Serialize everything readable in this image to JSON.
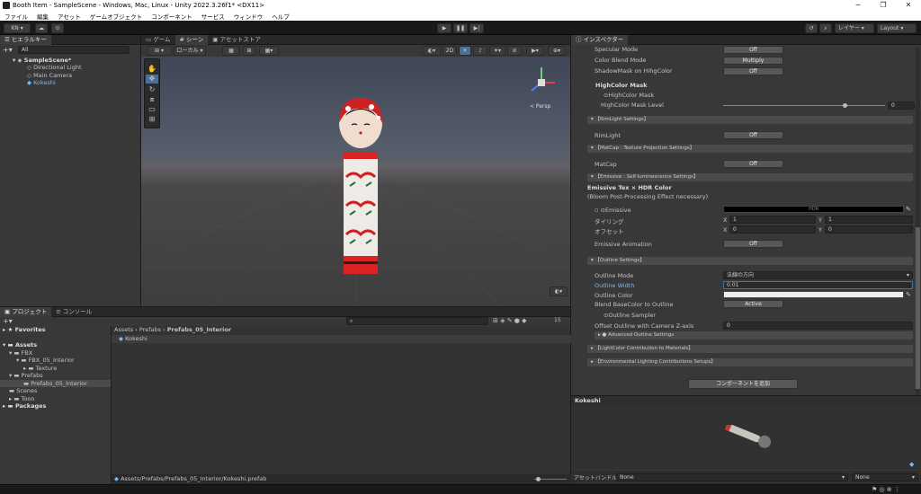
{
  "window": {
    "title": "Booth Item - SampleScene - Windows, Mac, Linux - Unity 2022.3.26f1* <DX11>"
  },
  "menu": [
    "ファイル",
    "編集",
    "アセット",
    "ゲームオブジェクト",
    "コンポーネント",
    "サービス",
    "ウィンドウ",
    "ヘルプ"
  ],
  "toolbar": {
    "account": "KN ▾",
    "layers": "レイヤー",
    "layout": "Layout"
  },
  "hierarchy": {
    "tab": "ヒエラルキー",
    "search": "All",
    "scene": "SampleScene*",
    "items": [
      "Directional Light",
      "Main Camera",
      "Kokeshi"
    ]
  },
  "scene_view": {
    "tabs": [
      "ゲーム",
      "シーン",
      "アセットストア"
    ],
    "pivot": "ローカル",
    "mode_2d": "2D",
    "persp": "< Persp"
  },
  "project": {
    "tabs": [
      "プロジェクト",
      "コンソール"
    ],
    "count": "15",
    "favorites": "Favorites",
    "assets": "Assets",
    "tree": [
      "FBX",
      "FBX_05_Interior",
      "Texture",
      "Prefabs",
      "Prefabs_05_Interior",
      "Scenes",
      "Toon"
    ],
    "packages": "Packages",
    "breadcrumb": [
      "Assets",
      "Prefabs",
      "Prefabs_05_Interior"
    ],
    "file": "Kokeshi",
    "path": "Assets/Prefabs/Prefabs_05_Interior/Kokeshi.prefab"
  },
  "inspector": {
    "tab": "インスペクター",
    "specular": {
      "label": "Specular Mode",
      "value": "Off"
    },
    "blend": {
      "label": "Color Blend Mode",
      "value": "Multiply"
    },
    "shadowmask": {
      "label": "ShadowMask on HihgColor",
      "value": "Off"
    },
    "highcolor_mask_title": "HighColor Mask",
    "highcolor_mask": "HighColor Mask",
    "highcolor_level": {
      "label": "HighColor Mask Level",
      "value": "0",
      "fraction": 0.75
    },
    "rimlight_hdr": "【RimLight Settings】",
    "rimlight": {
      "label": "RimLight",
      "value": "Off"
    },
    "matcap_hdr": "【MatCap : Texture Projection Settings】",
    "matcap": {
      "label": "MatCap",
      "value": "Off"
    },
    "emissive_hdr": "【Emissive : Self-luminescence Settings】",
    "emissive_title": "Emissive Tex × HDR Color",
    "emissive_sub": "(Bloom Post-Processing Effect necessary)",
    "emissive": "Emissive",
    "emissive_color_label": "HDR",
    "tiling": {
      "label": "タイリング",
      "x": "1",
      "y": "1"
    },
    "offset": {
      "label": "オフセット",
      "x": "0",
      "y": "0"
    },
    "emissive_anim": {
      "label": "Emissive Animation",
      "value": "Off"
    },
    "outline_hdr": "【Outline Settings】",
    "outline_mode": {
      "label": "Outline Mode",
      "value": "法線の方向"
    },
    "outline_width": {
      "label": "Outline Width",
      "value": "0.01"
    },
    "outline_color": {
      "label": "Outline Color"
    },
    "blend_base": {
      "label": "Blend BaseColor to Outline",
      "value": "Active"
    },
    "outline_sampler": "Outline Sampler",
    "offset_outline": {
      "label": "Offset Outline with Camera Z-axis",
      "value": "0"
    },
    "adv_outline": "● Advanced Outline Settings",
    "lightcolor_hdr": "【LightColor Contribution to Materials】",
    "env_hdr": "【Environmental Lighting Contributions Setups】",
    "add_component": "コンポーネントを追加",
    "preview_title": "Kokeshi",
    "assetbundle": {
      "label": "アセットバンドル",
      "value": "None",
      "variant": "None"
    }
  }
}
